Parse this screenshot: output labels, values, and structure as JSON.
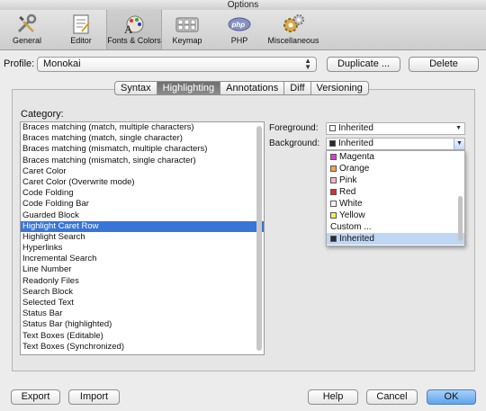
{
  "window": {
    "title": "Options"
  },
  "toolbar": {
    "items": [
      {
        "label": "General",
        "icon": "wrench-screwdriver-icon",
        "selected": false
      },
      {
        "label": "Editor",
        "icon": "editor-document-icon",
        "selected": false
      },
      {
        "label": "Fonts & Colors",
        "icon": "fonts-colors-icon",
        "selected": true
      },
      {
        "label": "Keymap",
        "icon": "keyboard-icon",
        "selected": false
      },
      {
        "label": "PHP",
        "icon": "php-icon",
        "selected": false
      },
      {
        "label": "Miscellaneous",
        "icon": "gears-icon",
        "selected": false
      }
    ]
  },
  "profile": {
    "label": "Profile:",
    "value": "Monokai",
    "duplicate_label": "Duplicate ...",
    "delete_label": "Delete"
  },
  "tabs": [
    {
      "label": "Syntax",
      "active": false
    },
    {
      "label": "Highlighting",
      "active": true
    },
    {
      "label": "Annotations",
      "active": false
    },
    {
      "label": "Diff",
      "active": false
    },
    {
      "label": "Versioning",
      "active": false
    }
  ],
  "category": {
    "label": "Category:",
    "items": [
      "Braces matching (match, multiple characters)",
      "Braces matching (match, single character)",
      "Braces matching (mismatch, multiple characters)",
      "Braces matching (mismatch, single character)",
      "Caret Color",
      "Caret Color (Overwrite mode)",
      "Code Folding",
      "Code Folding Bar",
      "Guarded Block",
      "Highlight Caret Row",
      "Highlight Search",
      "Hyperlinks",
      "Incremental Search",
      "Line Number",
      "Readonly Files",
      "Search Block",
      "Selected Text",
      "Status Bar",
      "Status Bar (highlighted)",
      "Text Boxes (Editable)",
      "Text Boxes (Synchronized)"
    ],
    "selected_index": 9
  },
  "foreground": {
    "label": "Foreground:",
    "value": "Inherited",
    "swatch": "#ffffff"
  },
  "background": {
    "label": "Background:",
    "value": "Inherited",
    "swatch": "#2b2b2b"
  },
  "dropdown": {
    "items": [
      {
        "label": "Magenta",
        "swatch": "#d63fd6"
      },
      {
        "label": "Orange",
        "swatch": "#f5a34a"
      },
      {
        "label": "Pink",
        "swatch": "#f6b8c8"
      },
      {
        "label": "Red",
        "swatch": "#d93030"
      },
      {
        "label": "White",
        "swatch": "#ffffff"
      },
      {
        "label": "Yellow",
        "swatch": "#f2f24a"
      },
      {
        "label": "Custom ...",
        "swatch": null
      },
      {
        "label": "Inherited",
        "swatch": "#2b2b2b"
      }
    ],
    "selected_index": 7
  },
  "footer": {
    "export_label": "Export",
    "import_label": "Import",
    "help_label": "Help",
    "cancel_label": "Cancel",
    "ok_label": "OK"
  }
}
